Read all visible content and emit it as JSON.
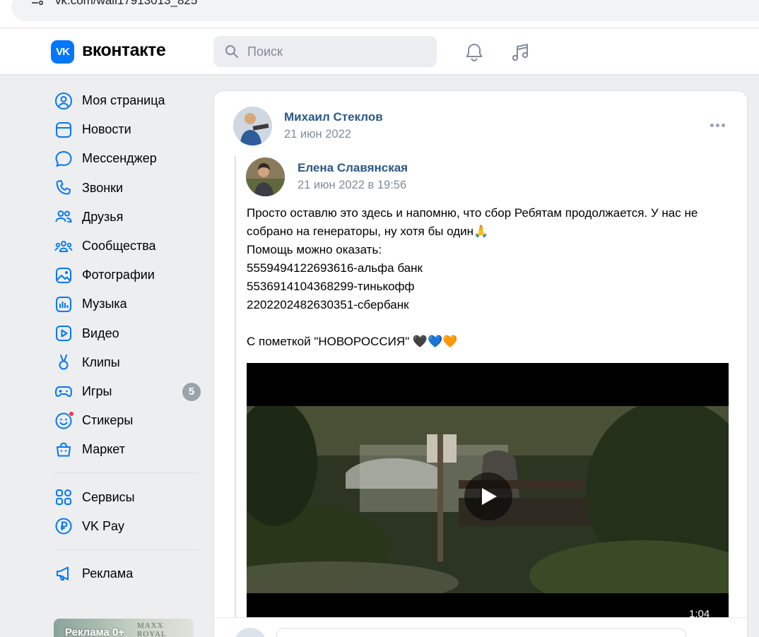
{
  "browser": {
    "url": "vk.com/wall17913013_825"
  },
  "header": {
    "logo_mark": "VK",
    "brand": "вконтакте",
    "search_placeholder": "Поиск"
  },
  "sidebar": {
    "items": [
      {
        "label": "Моя страница",
        "icon": "user-circle-icon"
      },
      {
        "label": "Новости",
        "icon": "news-icon"
      },
      {
        "label": "Мессенджер",
        "icon": "message-icon"
      },
      {
        "label": "Звонки",
        "icon": "phone-icon"
      },
      {
        "label": "Друзья",
        "icon": "friends-icon"
      },
      {
        "label": "Сообщества",
        "icon": "communities-icon"
      },
      {
        "label": "Фотографии",
        "icon": "photo-icon"
      },
      {
        "label": "Музыка",
        "icon": "music-icon"
      },
      {
        "label": "Видео",
        "icon": "video-icon"
      },
      {
        "label": "Клипы",
        "icon": "clips-icon"
      },
      {
        "label": "Игры",
        "icon": "gamepad-icon",
        "badge": "5"
      },
      {
        "label": "Стикеры",
        "icon": "sticker-icon"
      },
      {
        "label": "Маркет",
        "icon": "market-icon"
      }
    ],
    "items2": [
      {
        "label": "Сервисы",
        "icon": "services-icon"
      },
      {
        "label": "VK Pay",
        "icon": "vkpay-icon"
      }
    ],
    "items3": [
      {
        "label": "Реклама",
        "icon": "megaphone-icon"
      }
    ],
    "ad": {
      "label": "Реклама 0+",
      "brand": "MAXX ROYAL"
    }
  },
  "post": {
    "author": "Михаил Стеклов",
    "date": "21 июн 2022",
    "repost": {
      "author": "Елена Славянская",
      "date": "21 июн 2022 в 19:56",
      "lines": [
        "Просто оставлю это здесь и напомню, что сбор Ребятам продолжается. У нас не",
        "собрано на генераторы, ну хотя бы один🙏",
        "Помощь можно оказать:",
        "5559494122693616-альфа банк",
        "5536914104368299-тинькофф",
        "2202202482630351-сбербанк",
        "",
        "С пометкой \"НОВОРОССИЯ\" 🖤💙🧡"
      ],
      "video": {
        "duration": "1:04"
      }
    }
  },
  "colors": {
    "accent": "#0077ff",
    "link": "#2a5885",
    "secondary_text": "#818c99",
    "background": "#edeef0"
  }
}
